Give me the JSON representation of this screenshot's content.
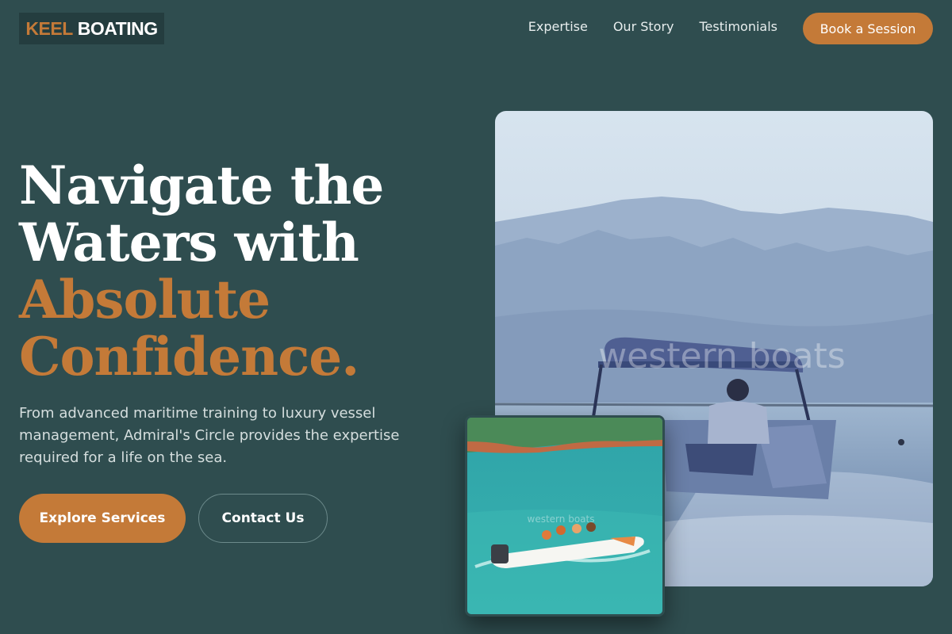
{
  "brand": {
    "part1": "KEEL",
    "part2": "BOATING"
  },
  "nav": {
    "links": [
      "Expertise",
      "Our Story",
      "Testimonials"
    ],
    "cta": "Book a Session"
  },
  "hero": {
    "title_line1": "Navigate the",
    "title_line2": "Waters with",
    "title_line3": "Absolute",
    "title_line4": "Confidence.",
    "subtitle": "From advanced maritime training to luxury vessel management, Admiral's Circle provides the expertise required for a life on the sea.",
    "primary_button": "Explore Services",
    "secondary_button": "Contact Us"
  },
  "images": {
    "main_watermark": "western boats",
    "small_watermark": "western boats"
  },
  "colors": {
    "background": "#2f4d4f",
    "accent": "#c47a38",
    "logo_bg": "#243d3f"
  }
}
